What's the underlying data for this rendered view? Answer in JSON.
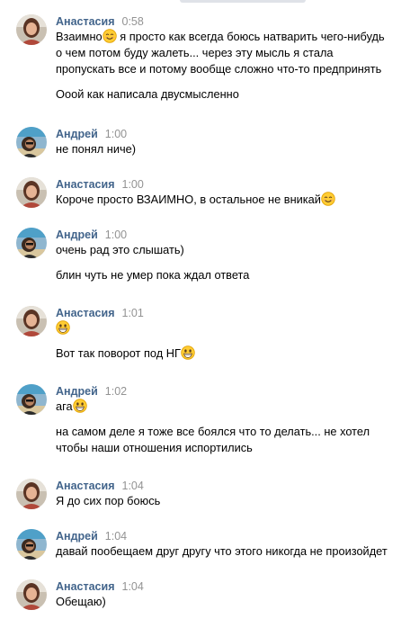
{
  "chat": {
    "messages": [
      {
        "author": "Анастасия",
        "time": "0:58",
        "avatar": "anastasia",
        "lines": [
          {
            "text": "Взаимно",
            "emoji": "smile",
            "suffix": " я просто как всегда боюсь натварить чего-нибудь"
          },
          {
            "text": "о чем потом буду жалеть... через эту мысль я стала"
          },
          {
            "text": "пропускать все и потому вообще сложно что-то предпринять"
          },
          {
            "text": "Ооой как написала двусмысленно"
          }
        ]
      },
      {
        "author": "Андрей",
        "time": "1:00",
        "avatar": "andrey",
        "lines": [
          {
            "text": "не понял ниче)"
          }
        ]
      },
      {
        "author": "Анастасия",
        "time": "1:00",
        "avatar": "anastasia",
        "lines": [
          {
            "text": "Короче просто ВЗАИМНО, в остальное не вникай",
            "emoji": "smile"
          }
        ]
      },
      {
        "author": "Андрей",
        "time": "1:00",
        "avatar": "andrey",
        "lines": [
          {
            "text": "очень рад это слышать)"
          },
          {
            "text": "блин чуть не умер пока ждал ответа"
          }
        ]
      },
      {
        "author": "Анастасия",
        "time": "1:01",
        "avatar": "anastasia",
        "lines": [
          {
            "text": "",
            "emoji": "grin"
          },
          {
            "text": "Вот так поворот под НГ",
            "emoji": "grin"
          }
        ]
      },
      {
        "author": "Андрей",
        "time": "1:02",
        "avatar": "andrey",
        "lines": [
          {
            "text": "ага",
            "emoji": "grin"
          },
          {
            "text": "на самом деле я тоже все боялся что то делать... не хотел"
          },
          {
            "text": "чтобы наши отношения испортились"
          }
        ]
      },
      {
        "author": "Анастасия",
        "time": "1:04",
        "avatar": "anastasia",
        "lines": [
          {
            "text": "Я до сих пор боюсь"
          }
        ]
      },
      {
        "author": "Андрей",
        "time": "1:04",
        "avatar": "andrey",
        "lines": [
          {
            "text": "давай пообещаем друг другу что этого никогда не произойдет"
          }
        ]
      },
      {
        "author": "Анастасия",
        "time": "1:04",
        "avatar": "anastasia",
        "lines": [
          {
            "text": "Обещаю)"
          }
        ]
      }
    ]
  },
  "colors": {
    "author": "#42648b",
    "time": "#939393",
    "text": "#000000",
    "emoji_face": "#ffcc33",
    "emoji_outline": "#e0a000"
  }
}
